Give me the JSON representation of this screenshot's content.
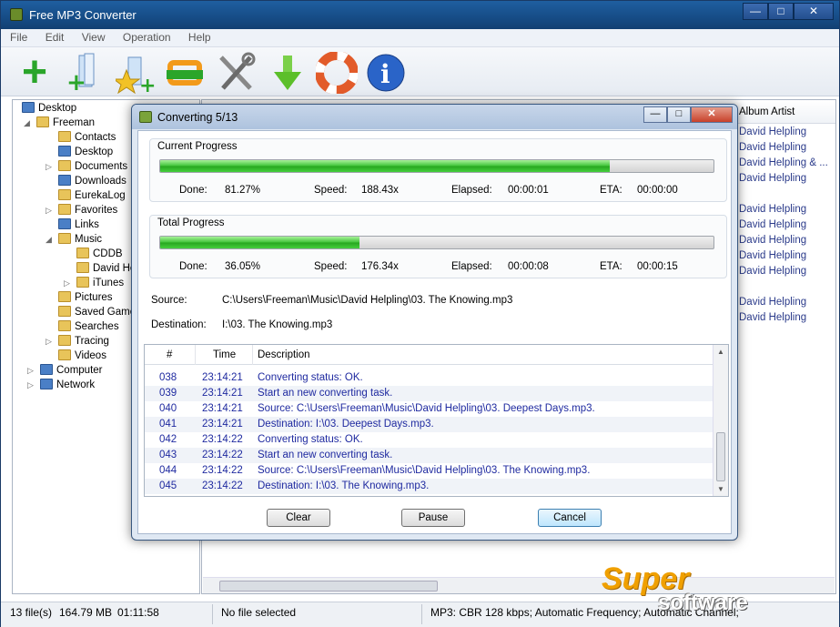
{
  "app": {
    "title": "Free MP3 Converter",
    "menu": [
      "File",
      "Edit",
      "View",
      "Operation",
      "Help"
    ]
  },
  "toolbar": {
    "icons": [
      "add-files-icon",
      "add-folder-icon",
      "add-stars-icon",
      "convert-icon",
      "tools-icon",
      "download-icon",
      "help-lifebuoy-icon",
      "info-icon"
    ]
  },
  "tree": {
    "items": [
      {
        "label": "Desktop"
      },
      {
        "label": "Freeman"
      },
      {
        "label": "Contacts"
      },
      {
        "label": "Desktop"
      },
      {
        "label": "Documents"
      },
      {
        "label": "Downloads"
      },
      {
        "label": "EurekaLog"
      },
      {
        "label": "Favorites"
      },
      {
        "label": "Links"
      },
      {
        "label": "Music"
      },
      {
        "label": "CDDB"
      },
      {
        "label": "David Helpling"
      },
      {
        "label": "iTunes"
      },
      {
        "label": "Pictures"
      },
      {
        "label": "Saved Games"
      },
      {
        "label": "Searches"
      },
      {
        "label": "Tracing"
      },
      {
        "label": "Videos"
      },
      {
        "label": "Computer"
      },
      {
        "label": "Network"
      }
    ]
  },
  "list": {
    "album_artist_header": "Album Artist",
    "artists": [
      "David Helpling",
      "David Helpling",
      "David Helpling & ...",
      "David Helpling",
      "",
      "David Helpling",
      "David Helpling",
      "David Helpling",
      "David Helpling",
      "David Helpling",
      "",
      "David Helpling",
      "David Helpling"
    ]
  },
  "dialog": {
    "title": "Converting 5/13",
    "current": {
      "label": "Current Progress",
      "progress": 0.8127,
      "done_label": "Done:",
      "done": "81.27%",
      "speed_label": "Speed:",
      "speed": "188.43x",
      "elapsed_label": "Elapsed:",
      "elapsed": "00:00:01",
      "eta_label": "ETA:",
      "eta": "00:00:00"
    },
    "total": {
      "label": "Total Progress",
      "progress": 0.3605,
      "done_label": "Done:",
      "done": "36.05%",
      "speed_label": "Speed:",
      "speed": "176.34x",
      "elapsed_label": "Elapsed:",
      "elapsed": "00:00:08",
      "eta_label": "ETA:",
      "eta": "00:00:15"
    },
    "source_label": "Source:",
    "source": "C:\\Users\\Freeman\\Music\\David Helpling\\03. The Knowing.mp3",
    "destination_label": "Destination:",
    "destination": "I:\\03. The Knowing.mp3",
    "log": {
      "headers": [
        "#",
        "Time",
        "Description"
      ],
      "rows": [
        {
          "n": "038",
          "time": "23:14:21",
          "desc": "Converting status: OK."
        },
        {
          "n": "039",
          "time": "23:14:21",
          "desc": "Start an new converting task."
        },
        {
          "n": "040",
          "time": "23:14:21",
          "desc": "Source:  C:\\Users\\Freeman\\Music\\David Helpling\\03. Deepest Days.mp3."
        },
        {
          "n": "041",
          "time": "23:14:21",
          "desc": "Destination: I:\\03. Deepest Days.mp3."
        },
        {
          "n": "042",
          "time": "23:14:22",
          "desc": "Converting status: OK."
        },
        {
          "n": "043",
          "time": "23:14:22",
          "desc": "Start an new converting task."
        },
        {
          "n": "044",
          "time": "23:14:22",
          "desc": "Source:  C:\\Users\\Freeman\\Music\\David Helpling\\03. The Knowing.mp3."
        },
        {
          "n": "045",
          "time": "23:14:22",
          "desc": "Destination: I:\\03. The Knowing.mp3."
        }
      ]
    },
    "buttons": {
      "clear": "Clear",
      "pause": "Pause",
      "cancel": "Cancel"
    }
  },
  "status": {
    "files": "13 file(s)",
    "size": "164.79 MB",
    "duration": "01:11:58",
    "selection": "No file selected",
    "format": "MP3:  CBR 128 kbps; Automatic Frequency; Automatic Channel;"
  },
  "watermark": {
    "line1": "Super",
    "line2": "software"
  }
}
